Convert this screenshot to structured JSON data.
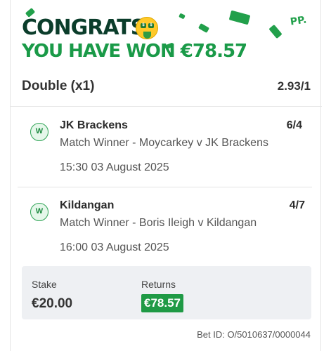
{
  "banner": {
    "headline": "CONGRATS!",
    "emoji_icon": "money-mouth-face-icon",
    "win_text": "YOU HAVE WON €78.57",
    "logo_text": "PP."
  },
  "bet": {
    "type": "Double (x1)",
    "odds": "2.93/1"
  },
  "legs": [
    {
      "status": "W",
      "name": "JK Brackens",
      "odds": "6/4",
      "market": "Match Winner - Moycarkey v JK Brackens",
      "time": "15:30 03 August 2025"
    },
    {
      "status": "W",
      "name": "Kildangan",
      "odds": "4/7",
      "market": "Match Winner - Boris Ileigh v Kildangan",
      "time": "16:00 03 August 2025"
    }
  ],
  "summary": {
    "stake_label": "Stake",
    "stake_value": "€20.00",
    "returns_label": "Returns",
    "returns_value": "€78.57"
  },
  "bet_id": "Bet ID: O/5010637/0000044",
  "colors": {
    "brand_green": "#1a9a48",
    "dark_green": "#0b3d2b",
    "returns_bg": "#1f9a45"
  }
}
